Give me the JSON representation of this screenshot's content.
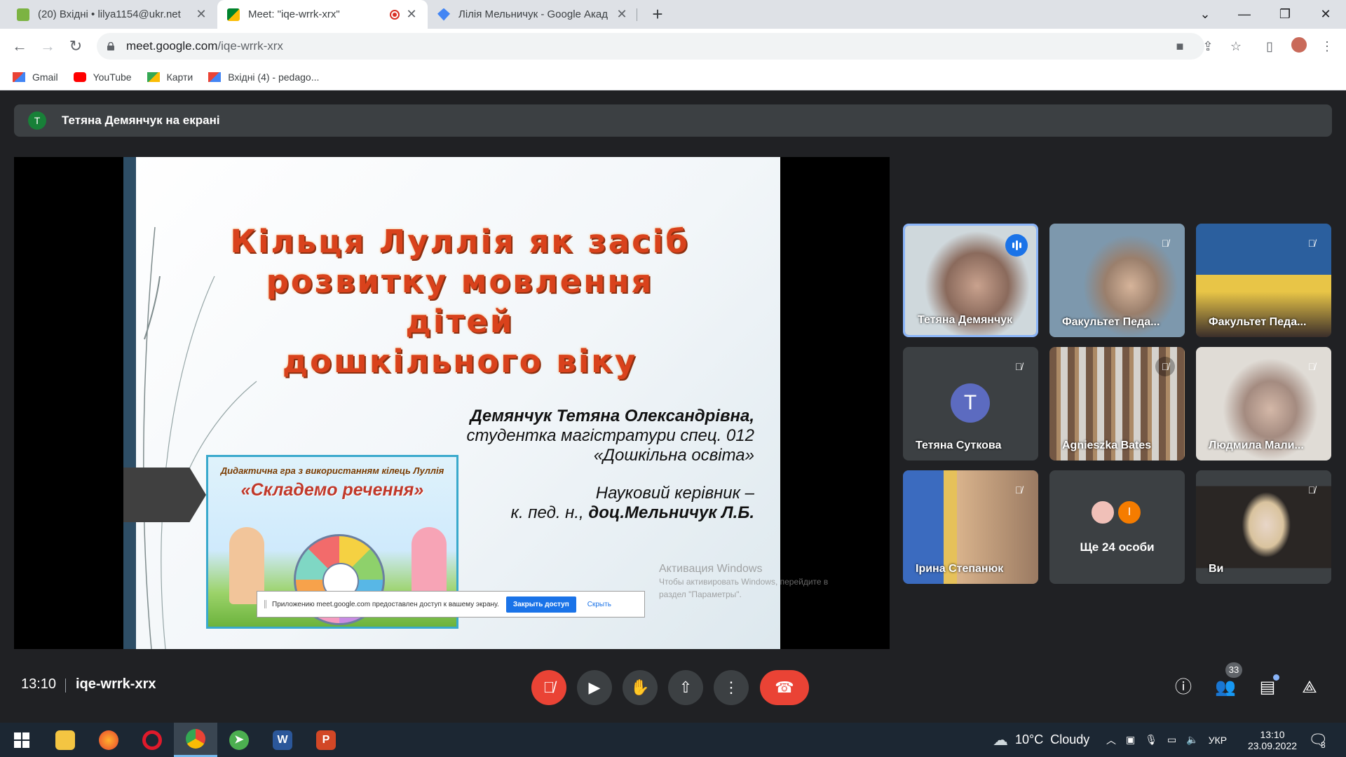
{
  "browser": {
    "tabs": [
      {
        "title": "(20) Вхідні • lilya1154@ukr.net",
        "icon": "mail-envelope-icon"
      },
      {
        "title": "Meet: \"iqe-wrrk-xrx\"",
        "icon": "google-meet-icon",
        "active": true
      },
      {
        "title": "Лілія Мельничук - Google Акад",
        "icon": "google-scholar-icon"
      }
    ],
    "url_host": "meet.google.com",
    "url_path": "/iqe-wrrk-xrx",
    "bookmarks": [
      {
        "label": "Gmail",
        "icon": "gmail-icon"
      },
      {
        "label": "YouTube",
        "icon": "youtube-icon"
      },
      {
        "label": "Карти",
        "icon": "maps-icon"
      },
      {
        "label": "Вхідні (4) - pedago...",
        "icon": "gmail-icon"
      }
    ]
  },
  "meet": {
    "presenting": {
      "initial": "Т",
      "text": "Тетяна Демянчук на екрані"
    },
    "slide": {
      "title_lines": [
        "Кільця Луллія як засіб",
        "розвитку мовлення дітей",
        "дошкільного віку"
      ],
      "author_name": "Демянчук Тетяна Олександрівна,",
      "author_line2": "студентка магістратури спец. 012",
      "author_line3": "«Дошкільна освіта»",
      "advisor_line1": "Науковий керівник –",
      "advisor_prefix": "к. пед. н., ",
      "advisor_name": "доц.Мельничук Л.Б.",
      "game_caption": "Дидактична гра з використанням кілець Луллія",
      "game_title": "«Складемо речення»"
    },
    "share_notice": {
      "text": "Приложению meet.google.com предоставлен доступ к вашему экрану.",
      "stop_label": "Закрыть доступ",
      "hide_label": "Скрыть"
    },
    "watermark": {
      "title": "Активация Windows",
      "line1": "Чтобы активировать Windows, перейдите в",
      "line2": "раздел \"Параметры\"."
    },
    "participants": [
      {
        "name": "Тетяна Демянчук",
        "speaking": true
      },
      {
        "name": "Факультет Педа...",
        "muted": true
      },
      {
        "name": "Факультет Педа...",
        "muted": true
      },
      {
        "name": "Тетяна Суткова",
        "muted": true,
        "avatar_letter": "T"
      },
      {
        "name": "Agnieszka Bates",
        "muted": true
      },
      {
        "name": "Людмила Мали...",
        "muted": true
      },
      {
        "name": "Ірина Степанюк",
        "muted": true
      },
      {
        "name": "Ще 24 особи",
        "more_initial": "I"
      },
      {
        "name": "Ви",
        "muted": true
      }
    ],
    "time": "13:10",
    "meeting_code": "iqe-wrrk-xrx",
    "participants_count": "33"
  },
  "taskbar": {
    "weather": "10°C  Cloudy",
    "language": "УКР",
    "time": "13:10",
    "date": "23.09.2022",
    "notifications": "3"
  },
  "colors": {
    "meet_bg": "#202124",
    "tile_bg": "#3c4043",
    "end_call": "#ea4335",
    "accent": "#1a73e8"
  }
}
